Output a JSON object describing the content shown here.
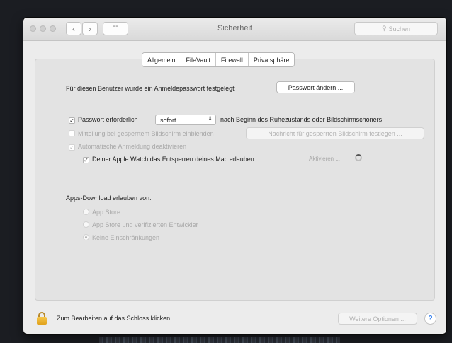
{
  "window": {
    "title": "Sicherheit",
    "search_placeholder": "Suchen",
    "nav_back_icon": "chevron-left-icon",
    "nav_forward_icon": "chevron-right-icon",
    "nav_grid_icon": "grid-icon"
  },
  "tabs": [
    {
      "label": "Allgemein",
      "selected": true
    },
    {
      "label": "FileVault",
      "selected": false
    },
    {
      "label": "Firewall",
      "selected": false
    },
    {
      "label": "Privatsphäre",
      "selected": false
    }
  ],
  "general": {
    "password_set_text": "Für diesen Benutzer wurde ein Anmeldepasswort festgelegt",
    "change_password_button": "Passwort ändern ...",
    "require_password_label": "Passwort erforderlich",
    "require_password_value": "sofort",
    "require_password_suffix": "nach Beginn des Ruhezustands oder Bildschirmschoners",
    "show_message_label": "Mitteilung bei gesperrtem Bildschirm einblenden",
    "set_message_button": "Nachricht für gesperrten Bildschirm festlegen ...",
    "disable_autologin_label": "Automatische Anmeldung deaktivieren",
    "apple_watch_label": "Deiner Apple Watch das Entsperren deines Mac erlauben",
    "activate_text": "Aktivieren ..."
  },
  "downloads": {
    "heading": "Apps-Download erlauben von:",
    "options": [
      {
        "label": "App Store",
        "selected": false
      },
      {
        "label": "App Store und verifizierten Entwickler",
        "selected": false
      },
      {
        "label": "Keine Einschränkungen",
        "selected": true
      }
    ]
  },
  "footer": {
    "lock_text": "Zum Bearbeiten auf das Schloss klicken.",
    "more_options_button": "Weitere Optionen ...",
    "help_label": "?"
  },
  "colors": {
    "lock_gold": "#f0b22c",
    "help_blue": "#3a84f0"
  }
}
